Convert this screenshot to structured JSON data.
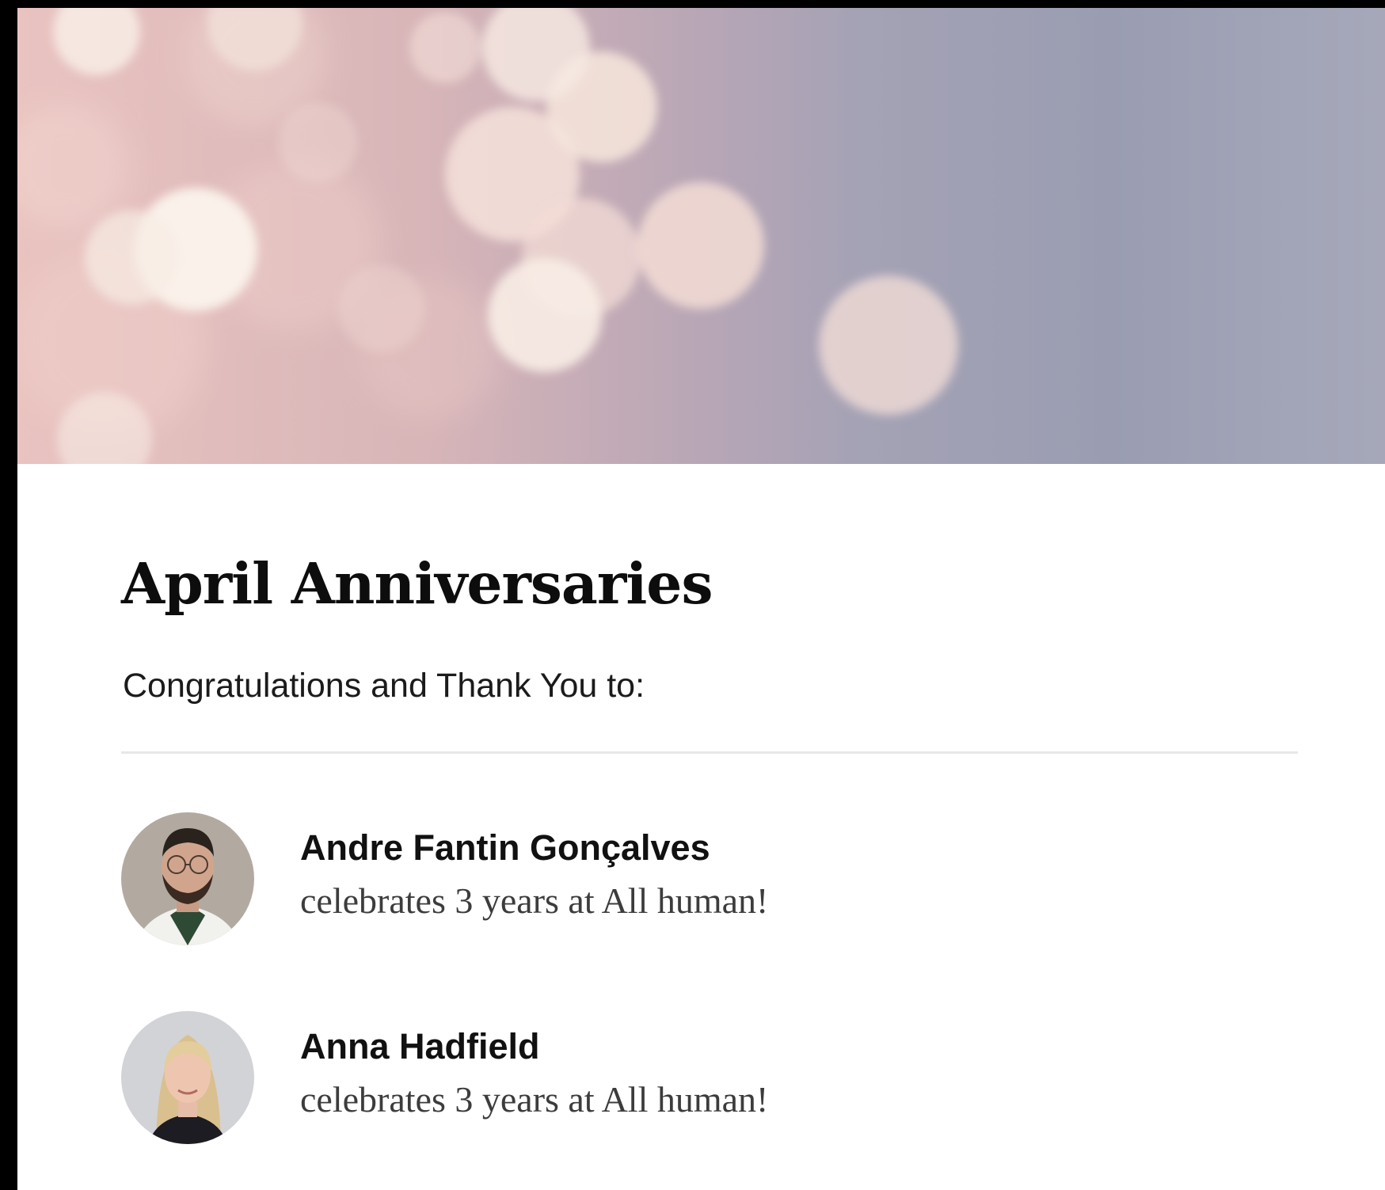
{
  "announcement": {
    "title": "April Anniversaries",
    "subtitle": "Congratulations and Thank You to:"
  },
  "people": [
    {
      "name": "Andre Fantin Gonçalves",
      "message": "celebrates 3 years at All human!"
    },
    {
      "name": "Anna Hadfield",
      "message": "celebrates 3 years at All human!"
    }
  ]
}
